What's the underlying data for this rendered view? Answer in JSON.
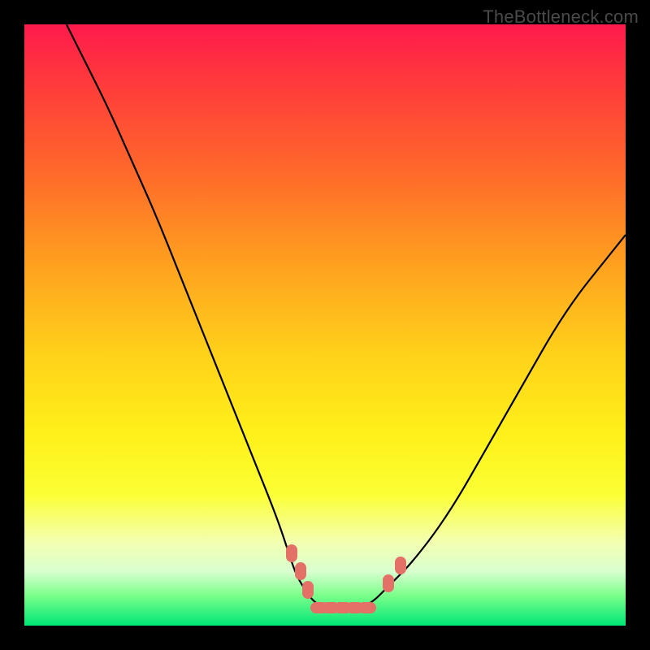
{
  "watermark": "TheBottleneck.com",
  "chart_data": {
    "type": "line",
    "title": "",
    "xlabel": "",
    "ylabel": "",
    "xlim": [
      0,
      100
    ],
    "ylim": [
      0,
      100
    ],
    "series": [
      {
        "name": "left-curve",
        "x": [
          7,
          10,
          14,
          18,
          22,
          26,
          30,
          34,
          38,
          42,
          44,
          45,
          46,
          48,
          50
        ],
        "values": [
          100,
          94,
          86,
          77,
          68,
          58,
          48,
          38,
          28,
          18,
          12,
          9,
          7,
          4,
          3
        ]
      },
      {
        "name": "right-curve",
        "x": [
          56,
          58,
          60,
          62,
          64,
          68,
          72,
          76,
          80,
          84,
          88,
          92,
          96,
          100
        ],
        "values": [
          3,
          4,
          6,
          8,
          10,
          15,
          21,
          28,
          35,
          42,
          49,
          55,
          60,
          65
        ]
      }
    ],
    "marker_groups": [
      {
        "name": "left-near-bottom",
        "points": [
          {
            "x": 44.5,
            "y": 12
          },
          {
            "x": 46.0,
            "y": 9
          },
          {
            "x": 47.2,
            "y": 6
          }
        ],
        "orientation": "vertical"
      },
      {
        "name": "bottom-flat",
        "points": [
          {
            "x": 49,
            "y": 3
          },
          {
            "x": 51,
            "y": 3
          },
          {
            "x": 53,
            "y": 3
          },
          {
            "x": 55,
            "y": 3
          },
          {
            "x": 57,
            "y": 3
          }
        ],
        "orientation": "horizontal"
      },
      {
        "name": "right-near-bottom",
        "points": [
          {
            "x": 60.5,
            "y": 7
          },
          {
            "x": 62.5,
            "y": 10
          }
        ],
        "orientation": "vertical"
      }
    ],
    "background_gradient": {
      "top": "#ff1a4d",
      "upper_mid": "#ffa11f",
      "lower_mid": "#fff01a",
      "bottom": "#00e676"
    }
  }
}
